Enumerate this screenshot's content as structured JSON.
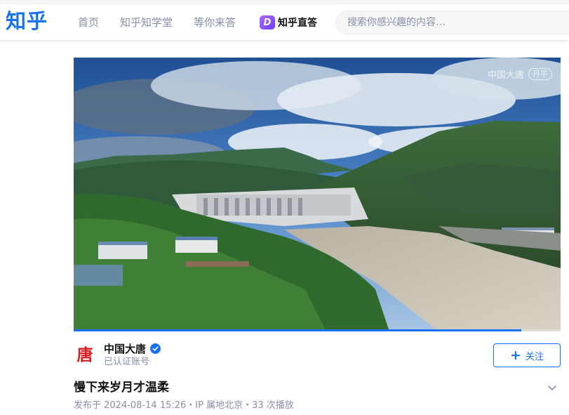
{
  "header": {
    "logo": "知乎",
    "nav": [
      "首页",
      "知乎知学堂",
      "等你来答"
    ],
    "zhida_label": "知乎直答",
    "zhida_mark": "D",
    "search_placeholder": "搜索你感兴趣的内容…"
  },
  "video": {
    "watermark_text": "中国大唐",
    "watermark_chip": "丹平",
    "progress": 0.92
  },
  "author": {
    "avatar_glyph": "唐",
    "name": "中国大唐",
    "subtitle": "已认证账号",
    "follow_label": "关注",
    "follow_icon": "plus-icon",
    "verified_icon": "verified-check-icon"
  },
  "post": {
    "title": "慢下来岁月才温柔",
    "meta": "发布于 2024-08-14 15:26・IP 属地北京・33 次播放"
  },
  "colors": {
    "accent": "#1772f6",
    "muted": "#8590a6",
    "brand_red": "#d7191b"
  }
}
